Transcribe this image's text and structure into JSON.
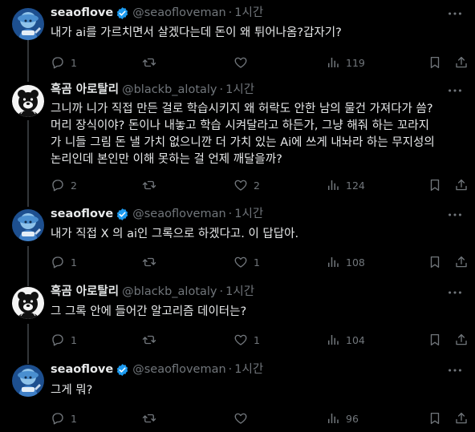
{
  "tweets": [
    {
      "name": "seaoflove",
      "verified": true,
      "handle": "@seaofloveman",
      "time": "1시간",
      "text": "내가 ai를 가르치면서 살겠다는데 돈이 왜 튀어나옴?갑자기?",
      "replies": "1",
      "reposts": "",
      "likes": "",
      "views": "119",
      "avatar": "blue-cartoon"
    },
    {
      "name": "흑곰 아로탈리",
      "verified": false,
      "handle": "@blackb_alotaly",
      "time": "1시간",
      "text": "그니까 니가 직접 만든 걸로 학습시키지 왜 허락도 안한 남의 물건 가져다가 씀?\n머리 장식이야? 돈이나 내놓고 학습 시켜달라고 하든가, 그냥 해줘 하는 꼬라지\n가 니들 그림 돈 낼 가치 없으니깐 더 가치 있는 Ai에 쓰게 내놔라 하는 무지성의\n논리인데 본인만 이해 못하는 걸 언제 깨달을까?",
      "replies": "2",
      "reposts": "",
      "likes": "2",
      "views": "124",
      "avatar": "bw-bear"
    },
    {
      "name": "seaoflove",
      "verified": true,
      "handle": "@seaofloveman",
      "time": "1시간",
      "text": "내가 직접 X 의 ai인 그록으로 하겠다고. 이 답답아.",
      "replies": "1",
      "reposts": "",
      "likes": "1",
      "views": "108",
      "avatar": "blue-cartoon"
    },
    {
      "name": "흑곰 아로탈리",
      "verified": false,
      "handle": "@blackb_alotaly",
      "time": "1시간",
      "text": "그 그록 안에 들어간 알고리즘 데이터는?",
      "replies": "1",
      "reposts": "",
      "likes": "1",
      "views": "104",
      "avatar": "bw-bear"
    },
    {
      "name": "seaoflove",
      "verified": true,
      "handle": "@seaofloveman",
      "time": "1시간",
      "text": "그게 뭐?",
      "replies": "1",
      "reposts": "",
      "likes": "",
      "views": "96",
      "avatar": "blue-cartoon"
    }
  ],
  "colors": {
    "background": "#000000",
    "text": "#e7e9ea",
    "muted": "#71767b",
    "verified": "#1d9bf0",
    "divider": "#2f3336"
  },
  "icons": [
    "more-icon",
    "reply-icon",
    "repost-icon",
    "like-icon",
    "views-icon",
    "bookmark-icon",
    "share-icon",
    "verified-badge-icon"
  ]
}
